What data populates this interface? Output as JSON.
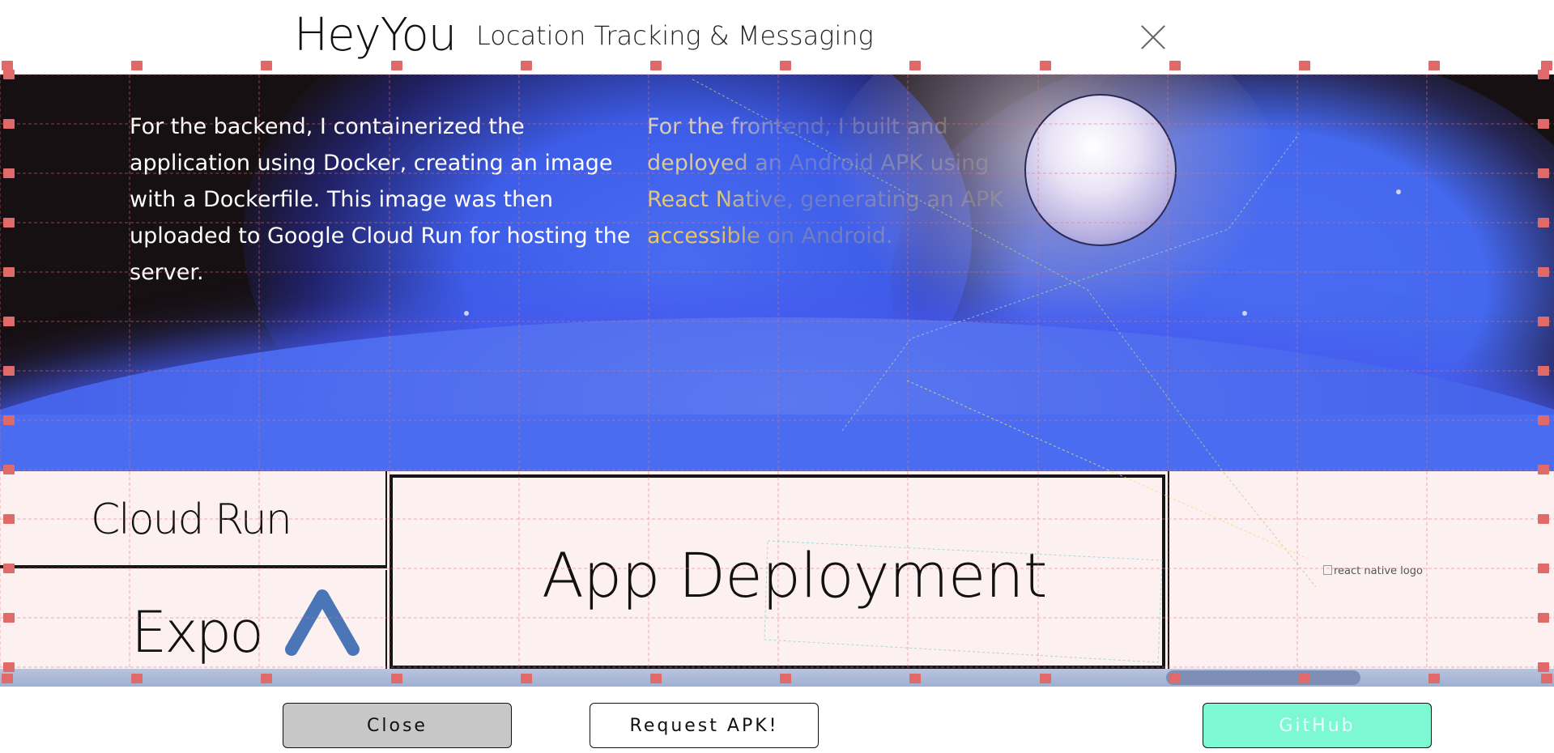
{
  "header": {
    "title": "HeyYou",
    "subtitle": "Location Tracking & Messaging",
    "close_icon": "close-icon"
  },
  "hero": {
    "backend_text": "For the backend, I containerized the application using Docker, creating an image with a Dockerfile. This image was then uploaded to Google Cloud Run for hosting the server.",
    "frontend_text": "For the frontend, I built and deployed an Android APK using React Native, generating an APK accessible on Android."
  },
  "tiles": {
    "cloud_run": "Cloud Run",
    "expo": "Expo",
    "app_deployment": "App Deployment",
    "react_native_logo_alt": "react native logo"
  },
  "footer": {
    "close_label": "Close",
    "request_apk_label": "Request APK!",
    "github_label": "GitHub"
  },
  "colors": {
    "hero_blue": "#4a6cf0",
    "tile_bg": "#fcf0f0",
    "github_button": "#7cf9d3",
    "close_button": "#c7c7c7",
    "expo_logo": "#4a76b8"
  }
}
